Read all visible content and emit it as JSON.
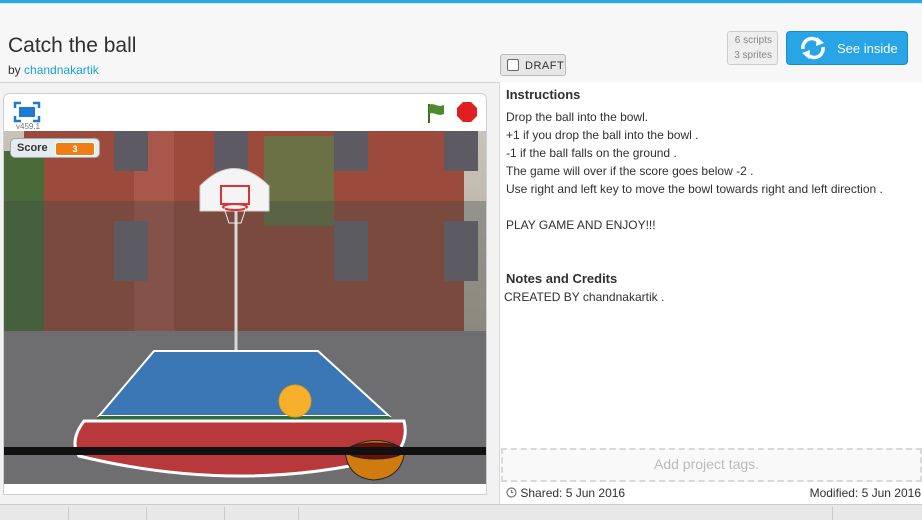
{
  "project": {
    "title": "Catch the ball",
    "by_label": "by",
    "author": "chandnakartik",
    "draft_label": "DRAFT",
    "scripts_count": "6 scripts",
    "sprites_count": "3 sprites",
    "see_inside_label": "See inside"
  },
  "player": {
    "version": "v459.1",
    "score_label": "Score",
    "score_value": "3"
  },
  "instructions": {
    "title": "Instructions",
    "lines": [
      "Drop the ball into the bowl.",
      "+1 if you drop the ball into the bowl .",
      "-1 if the ball falls on the ground .",
      "The game will over if the score goes below -2 .",
      "Use right and left key to move the bowl towards right and left direction .",
      "",
      "PLAY GAME AND ENJOY!!!"
    ]
  },
  "notes": {
    "title": "Notes and Credits",
    "text": "CREATED BY chandnakartik ."
  },
  "tags": {
    "placeholder": "Add project tags."
  },
  "footer": {
    "shared": "Shared: 5 Jun 2016",
    "modified": "Modified: 5 Jun 2016"
  },
  "colors": {
    "accent": "#25aae1",
    "see_inside": "#27a5e6",
    "score_value": "#ee7d16",
    "flag": "#4c8b2b",
    "stop": "#e02020"
  }
}
